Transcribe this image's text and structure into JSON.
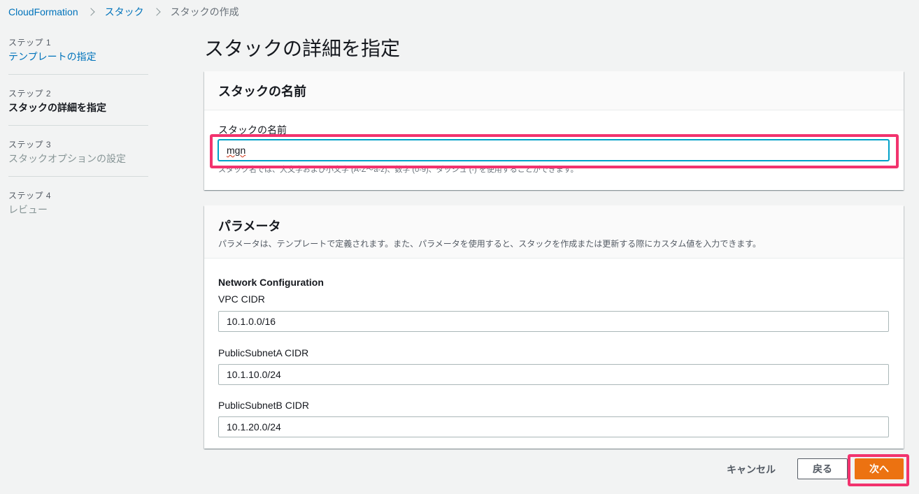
{
  "breadcrumb": {
    "items": [
      "CloudFormation",
      "スタック"
    ],
    "current": "スタックの作成"
  },
  "steps": [
    {
      "num": "ステップ 1",
      "name": "テンプレートの指定",
      "state": "link"
    },
    {
      "num": "ステップ 2",
      "name": "スタックの詳細を指定",
      "state": "active"
    },
    {
      "num": "ステップ 3",
      "name": "スタックオプションの設定",
      "state": "disabled"
    },
    {
      "num": "ステップ 4",
      "name": "レビュー",
      "state": "disabled"
    }
  ],
  "page_title": "スタックの詳細を指定",
  "stack_name_panel": {
    "title": "スタックの名前",
    "field_label": "スタックの名前",
    "value": "mgn",
    "constraint": "スタック名では、大文字および小文字 (A-Z〜a-z)、数字 (0-9)、ダッシュ (-) を使用することができます。"
  },
  "parameters_panel": {
    "title": "パラメータ",
    "description": "パラメータは、テンプレートで定義されます。また、パラメータを使用すると、スタックを作成または更新する際にカスタム値を入力できます。",
    "group_title": "Network Configuration",
    "fields": [
      {
        "label": "VPC CIDR",
        "value": "10.1.0.0/16"
      },
      {
        "label": "PublicSubnetA CIDR",
        "value": "10.1.10.0/24"
      },
      {
        "label": "PublicSubnetB CIDR",
        "value": "10.1.20.0/24"
      }
    ]
  },
  "buttons": {
    "cancel": "キャンセル",
    "back": "戻る",
    "next": "次へ"
  },
  "colors": {
    "link": "#0073bb",
    "primary": "#ec7211",
    "focus": "#00a1c9",
    "annotation": "#f2336e"
  }
}
